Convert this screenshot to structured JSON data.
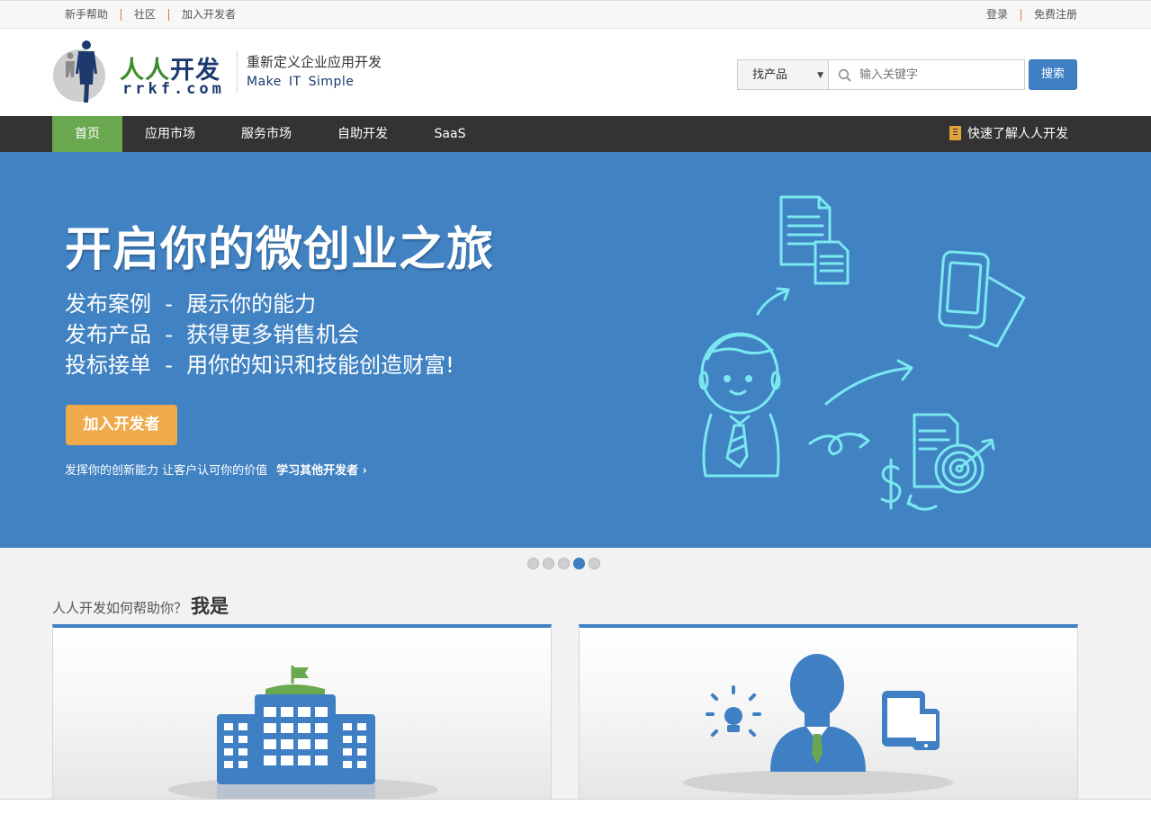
{
  "topbar": {
    "left_links": [
      "新手帮助",
      "社区",
      "加入开发者"
    ],
    "right_links": [
      "登录",
      "免费注册"
    ]
  },
  "logo": {
    "title_green": "人人",
    "title_blue": "开发",
    "subtitle": "rrkf.com"
  },
  "slogan": {
    "line1": "重新定义企业应用开发",
    "words": [
      "Make",
      "IT",
      "Simple"
    ]
  },
  "search": {
    "category": "找产品",
    "placeholder": "输入关键字",
    "button": "搜索"
  },
  "nav": {
    "items": [
      "首页",
      "应用市场",
      "服务市场",
      "自助开发",
      "SaaS"
    ],
    "active_index": 0,
    "quick_link": "快速了解人人开发"
  },
  "banner": {
    "title": "开启你的微创业之旅",
    "lines": [
      "发布案例  -  展示你的能力",
      "发布产品  -  获得更多销售机会",
      "投标接单  -  用你的知识和技能创造财富!"
    ],
    "button": "加入开发者",
    "footer": "发挥你的创新能力   让客户认可你的价值",
    "learn_link": "学习其他开发者 ›",
    "illustration_color": "#7ae8f0"
  },
  "carousel": {
    "count": 5,
    "active_index": 3
  },
  "section": {
    "question": "人人开发如何帮助你？",
    "answer": "我是"
  },
  "colors": {
    "nav_active": "#6aa84f",
    "accent_blue": "#3f7fc4",
    "banner_bg": "#4182c3",
    "join_orange": "#eeaa4b"
  }
}
